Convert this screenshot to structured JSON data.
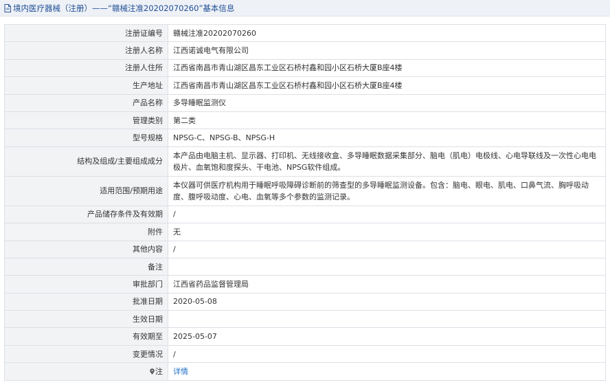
{
  "header": {
    "title": "境内医疗器械（注册）——“赣械注准20202070260”基本信息",
    "icon": "document-icon"
  },
  "rows": [
    {
      "label": "注册证编号",
      "value": "赣械注准20202070260"
    },
    {
      "label": "注册人名称",
      "value": "江西诺诚电气有限公司"
    },
    {
      "label": "注册人住所",
      "value": "江西省南昌市青山湖区昌东工业区石桥村鑫和园小区石桥大厦B座4楼"
    },
    {
      "label": "生产地址",
      "value": "江西省南昌市青山湖区昌东工业区石桥村鑫和园小区石桥大厦B座4楼"
    },
    {
      "label": "产品名称",
      "value": "多导睡眠监测仪"
    },
    {
      "label": "管理类别",
      "value": "第二类"
    },
    {
      "label": "型号规格",
      "value": "NPSG-C、NPSG-B、NPSG-H"
    },
    {
      "label": "结构及组成/主要组成成分",
      "value": "本产品由电脑主机、显示器、打印机、无线接收盒、多导睡眠数据采集部分、脑电（肌电）电极线、心电导联线及一次性心电电极片、血氧饱和度探头、干电池、NPSG软件组成。"
    },
    {
      "label": "适用范围/预期用途",
      "value": "本仪器可供医疗机构用于睡眠呼吸障碍诊断前的筛查型的多导睡眠监测设备。包含：脑电、眼电、肌电、口鼻气流、胸呼吸动度、腹呼吸动度、心电、血氧等多个参数的监测记录。"
    },
    {
      "label": "产品储存条件及有效期",
      "value": "/"
    },
    {
      "label": "附件",
      "value": "无"
    },
    {
      "label": "其他内容",
      "value": "/"
    },
    {
      "label": "备注",
      "value": ""
    },
    {
      "label": "审批部门",
      "value": "江西省药品监督管理局"
    },
    {
      "label": "批准日期",
      "value": "2020-05-08"
    },
    {
      "label": "生效日期",
      "value": ""
    },
    {
      "label": "有效期至",
      "value": "2025-05-07"
    },
    {
      "label": "变更情况",
      "value": "/"
    }
  ],
  "note": {
    "label": "注",
    "icon": "pin-icon",
    "link_text": "详情"
  },
  "colors": {
    "title": "#1f4e96",
    "link": "#1f6fc7",
    "label_bg": "#f2f3f5",
    "border": "#dcdfe6"
  }
}
